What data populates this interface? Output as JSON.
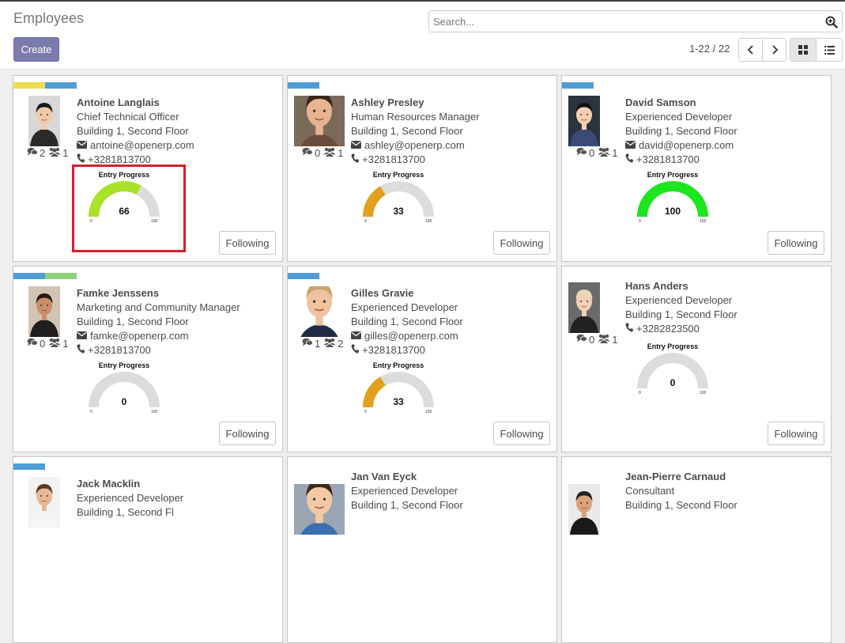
{
  "header": {
    "title": "Employees",
    "search_placeholder": "Search...",
    "create_label": "Create",
    "pager": "1-22 / 22"
  },
  "icons": {
    "search": "zoom-in-icon",
    "prev": "chevron-left-icon",
    "next": "chevron-right-icon",
    "kanban": "grid-view-icon",
    "list": "list-view-icon",
    "messages": "comments-icon",
    "followers": "users-icon",
    "email": "envelope-icon",
    "phone": "phone-icon"
  },
  "colors": {
    "create_button": "#7c7bad",
    "tag_yellow": "#f0dc4b",
    "tag_blue": "#4f9cd6",
    "tag_green": "#8fd27b",
    "gauge_track": "#dcdcdc",
    "highlight": "#d4202a"
  },
  "gauge_label": "Entry Progress",
  "gauge_min": "0",
  "gauge_max": "100",
  "follow_label": "Following",
  "employees": [
    {
      "name": "Antoine Langlais",
      "job": "Chief Technical Officer",
      "location": "Building 1, Second Floor",
      "email": "antoine@openerp.com",
      "phone": "+3281813700",
      "messages": "2",
      "followers": "1",
      "progress": 66,
      "progress_text": "66",
      "gauge_color": "#a8e22a",
      "tags": [
        "#f0dc4b",
        "#4f9cd6"
      ]
    },
    {
      "name": "Ashley Presley",
      "job": "Human Resources Manager",
      "location": "Building 1, Second Floor",
      "email": "ashley@openerp.com",
      "phone": "+3281813700",
      "messages": "0",
      "followers": "1",
      "progress": 33,
      "progress_text": "33",
      "gauge_color": "#e3a01e",
      "tags": [
        "#4f9cd6"
      ]
    },
    {
      "name": "David Samson",
      "job": "Experienced Developer",
      "location": "Building 1, Second Floor",
      "email": "david@openerp.com",
      "phone": "+3281813700",
      "messages": "0",
      "followers": "1",
      "progress": 100,
      "progress_text": "100",
      "gauge_color": "#1ee61e",
      "tags": [
        "#4f9cd6"
      ]
    },
    {
      "name": "Famke Jenssens",
      "job": "Marketing and Community Manager",
      "location": "Building 1, Second Floor",
      "email": "famke@openerp.com",
      "phone": "+3281813700",
      "messages": "0",
      "followers": "1",
      "progress": 0,
      "progress_text": "0",
      "gauge_color": "#dcdcdc",
      "tags": [
        "#4f9cd6",
        "#8fd27b"
      ]
    },
    {
      "name": "Gilles Gravie",
      "job": "Experienced Developer",
      "location": "Building 1, Second Floor",
      "email": "gilles@openerp.com",
      "phone": "+3281813700",
      "messages": "1",
      "followers": "2",
      "progress": 33,
      "progress_text": "33",
      "gauge_color": "#e3a01e",
      "tags": [
        "#4f9cd6"
      ]
    },
    {
      "name": "Hans Anders",
      "job": "Experienced Developer",
      "location": "Building 1, Second Floor",
      "email": "",
      "phone": "+3282823500",
      "messages": "0",
      "followers": "1",
      "progress": 0,
      "progress_text": "0",
      "gauge_color": "#dcdcdc",
      "tags": []
    },
    {
      "name": "Jack Macklin",
      "job": "Experienced Developer",
      "location": "Building 1, Second Fl",
      "tags": [
        "#4f9cd6"
      ]
    },
    {
      "name": "Jan Van Eyck",
      "job": "Experienced Developer",
      "location": "Building 1, Second Floor",
      "tags": []
    },
    {
      "name": "Jean-Pierre Carnaud",
      "job": "Consultant",
      "location": "Building 1, Second Floor",
      "tags": []
    }
  ]
}
